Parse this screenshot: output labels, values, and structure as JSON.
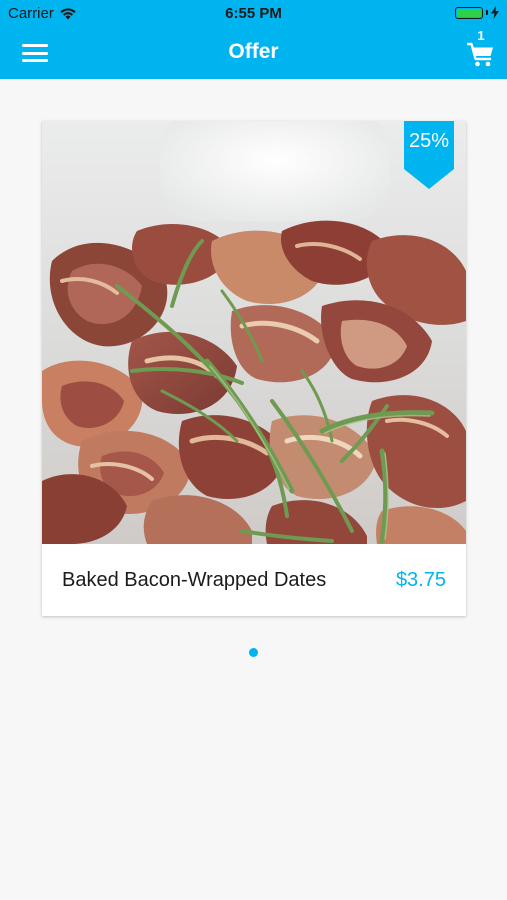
{
  "status_bar": {
    "carrier": "Carrier",
    "time": "6:55 PM",
    "battery_level": 1.0,
    "battery_color": "#2bd14b",
    "icons": [
      "wifi-icon",
      "battery-icon",
      "charging-bolt-icon"
    ]
  },
  "nav": {
    "title": "Offer",
    "menu_icon": "hamburger-menu-icon",
    "cart_icon": "shopping-cart-icon",
    "cart_count": "1",
    "bar_color": "#00b4f0"
  },
  "offer": {
    "name": "Baked Bacon-Wrapped Dates",
    "price": "$3.75",
    "discount": "25%",
    "image_icon": "bacon-with-rosemary-photo",
    "accent_color": "#00b4f0"
  },
  "pager": {
    "page_count": 1,
    "active_index": 0
  }
}
